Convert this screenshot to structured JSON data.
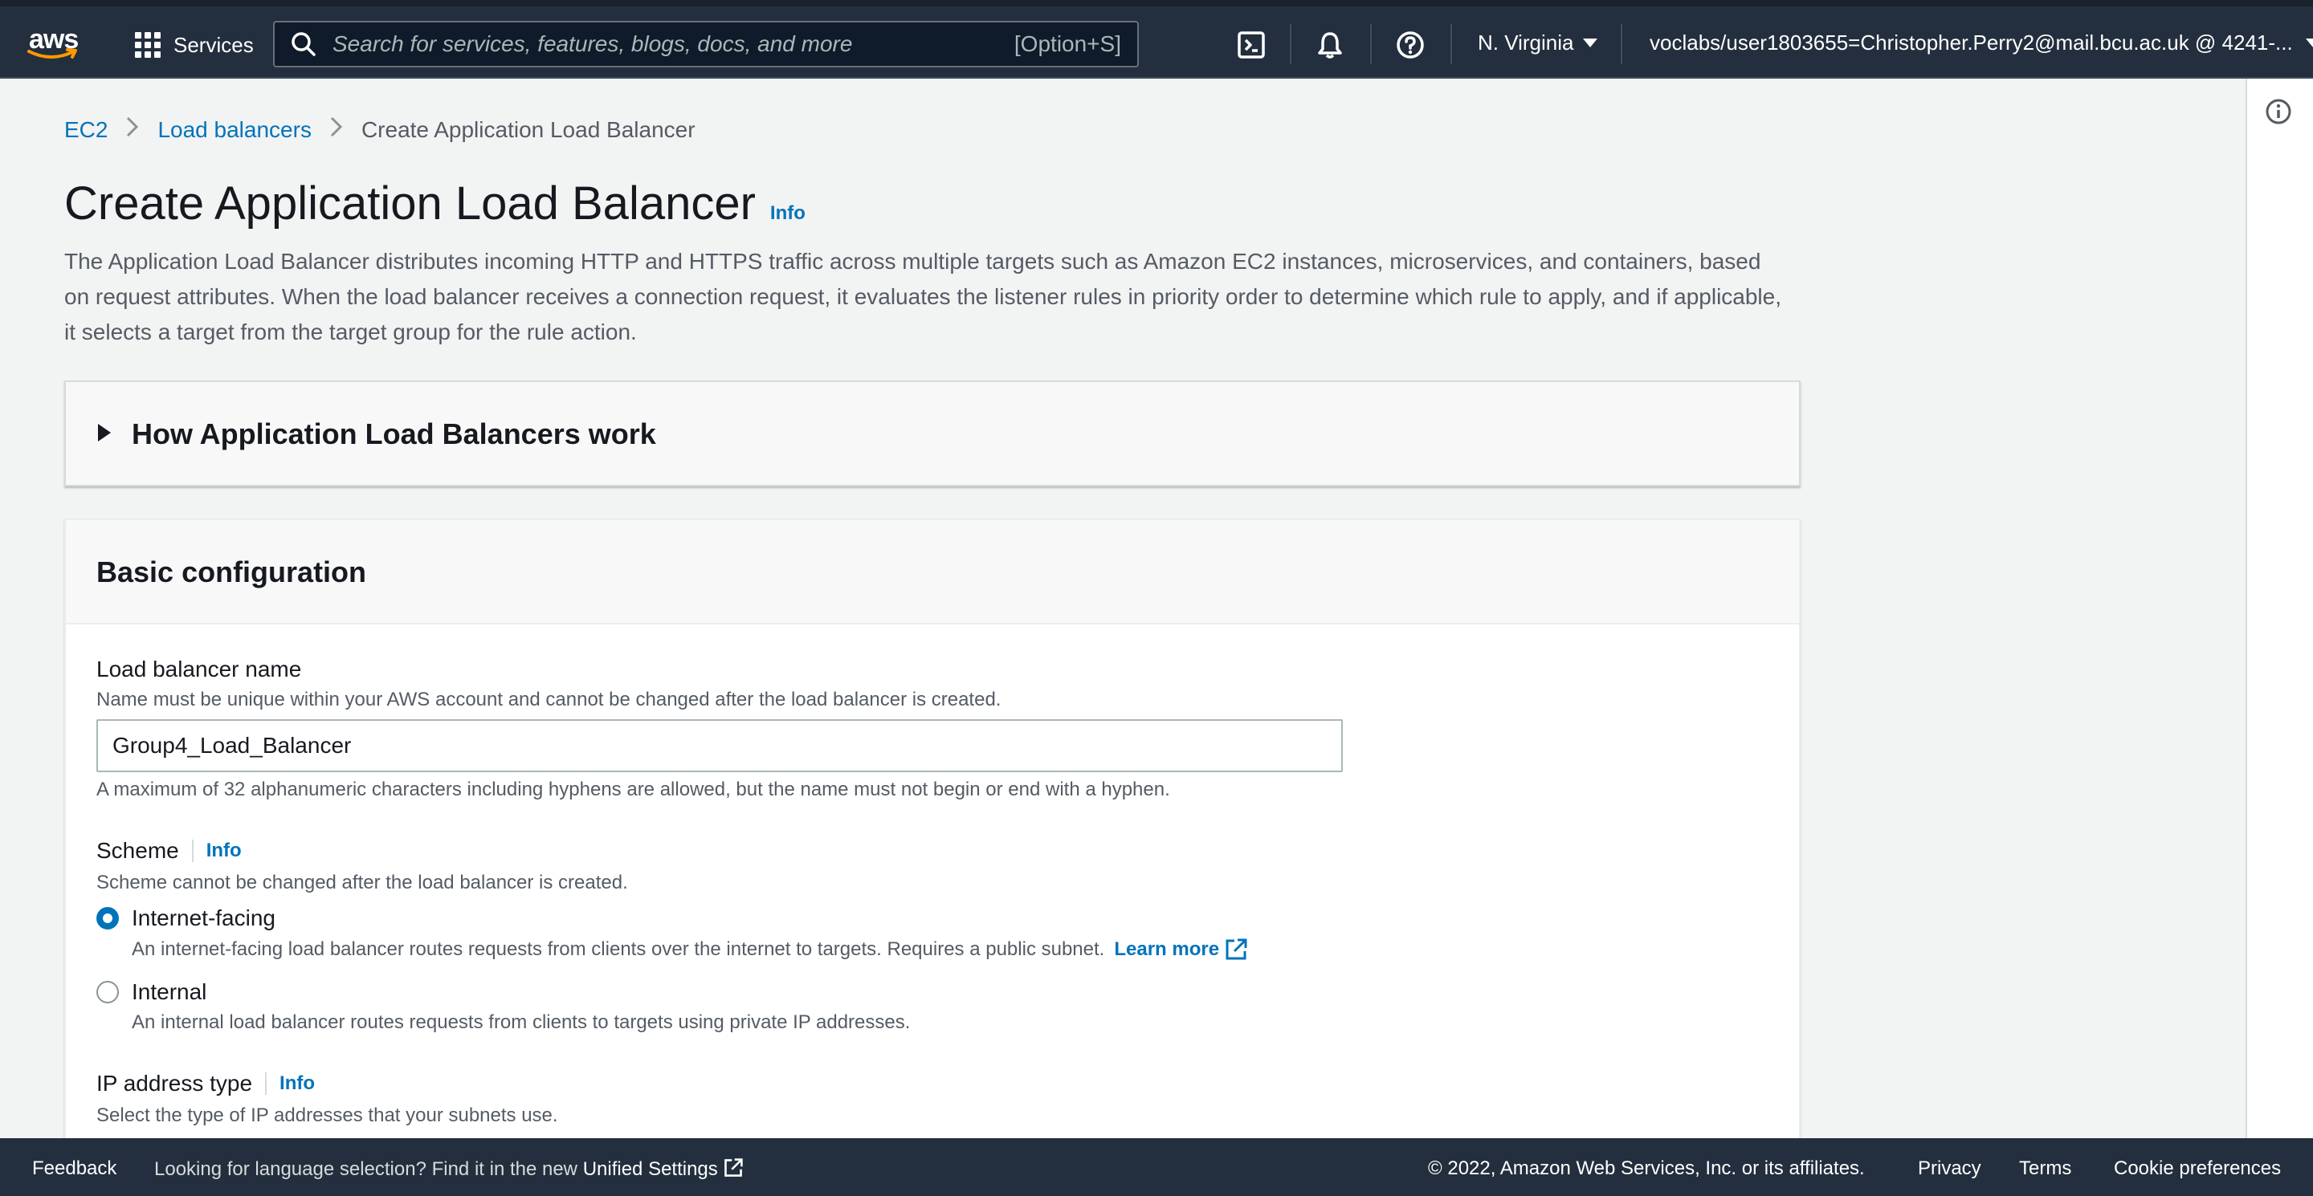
{
  "header": {
    "logo_text": "aws",
    "services_label": "Services",
    "search_placeholder": "Search for services, features, blogs, docs, and more",
    "search_shortcut": "[Option+S]",
    "region": "N. Virginia",
    "account": "voclabs/user1803655=Christopher.Perry2@mail.bcu.ac.uk @ 4241-..."
  },
  "breadcrumb": {
    "items": [
      "EC2",
      "Load balancers"
    ],
    "current": "Create Application Load Balancer"
  },
  "page": {
    "title": "Create Application Load Balancer",
    "info": "Info",
    "description": "The Application Load Balancer distributes incoming HTTP and HTTPS traffic across multiple targets such as Amazon EC2 instances, microservices, and containers, based on request attributes. When the load balancer receives a connection request, it evaluates the listener rules in priority order to determine which rule to apply, and if applicable, it selects a target from the target group for the rule action."
  },
  "expander": {
    "label": "How Application Load Balancers work",
    "expanded": false
  },
  "basic_config": {
    "title": "Basic configuration",
    "lb_name": {
      "label": "Load balancer name",
      "description": "Name must be unique within your AWS account and cannot be changed after the load balancer is created.",
      "value": "Group4_Load_Balancer",
      "constraint": "A maximum of 32 alphanumeric characters including hyphens are allowed, but the name must not begin or end with a hyphen."
    },
    "scheme": {
      "label": "Scheme",
      "info": "Info",
      "description": "Scheme cannot be changed after the load balancer is created.",
      "options": [
        {
          "label": "Internet-facing",
          "description": "An internet-facing load balancer routes requests from clients over the internet to targets. Requires a public subnet.",
          "link": "Learn more",
          "selected": true
        },
        {
          "label": "Internal",
          "description": "An internal load balancer routes requests from clients to targets using private IP addresses.",
          "selected": false
        }
      ]
    },
    "ip_type": {
      "label": "IP address type",
      "info": "Info",
      "description": "Select the type of IP addresses that your subnets use."
    }
  },
  "footer": {
    "feedback": "Feedback",
    "language_text": "Looking for language selection? Find it in the new",
    "unified_settings": "Unified Settings",
    "copyright": "© 2022, Amazon Web Services, Inc. or its affiliates.",
    "privacy": "Privacy",
    "terms": "Terms",
    "cookies": "Cookie preferences"
  },
  "colors": {
    "nav_bg": "#232f3e",
    "link": "#0073bb",
    "page_bg": "#f2f3f3"
  },
  "icons": [
    "aws-smile-icon",
    "apps-grid-icon",
    "search-icon",
    "cloudshell-icon",
    "bell-icon",
    "help-icon",
    "caret-down-icon",
    "info-circle-icon",
    "chevron-right-icon",
    "caret-right-icon",
    "external-link-icon"
  ]
}
